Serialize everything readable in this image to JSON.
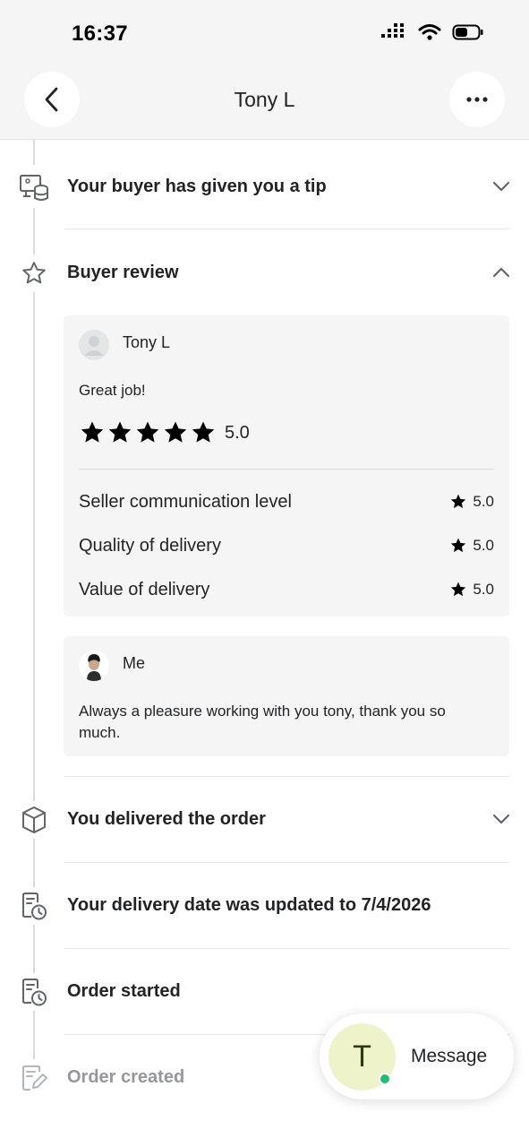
{
  "status_bar": {
    "time": "16:37"
  },
  "header": {
    "title": "Tony L"
  },
  "events": [
    {
      "title": "Your buyer has given you a tip",
      "icon": "tip-icon",
      "expanded": false
    },
    {
      "title": "Buyer review",
      "icon": "star-outline-icon",
      "expanded": true
    },
    {
      "title": "You delivered the order",
      "icon": "package-icon",
      "expanded": false
    },
    {
      "title": "Your delivery date was updated to 7/4/2026",
      "icon": "calendar-clock-icon"
    },
    {
      "title": "Order started",
      "icon": "calendar-clock-icon"
    },
    {
      "title": "Order created",
      "icon": "edit-document-icon"
    }
  ],
  "review": {
    "reviewer": "Tony L",
    "text": "Great job!",
    "stars": 5,
    "overall": "5.0",
    "ratings": [
      {
        "label": "Seller communication level",
        "value": "5.0"
      },
      {
        "label": "Quality of delivery",
        "value": "5.0"
      },
      {
        "label": "Value of delivery",
        "value": "5.0"
      }
    ]
  },
  "reply": {
    "author": "Me",
    "text": "Always a pleasure working with you tony, thank you so much."
  },
  "message_button": {
    "initial": "T",
    "label": "Message",
    "online": true
  },
  "colors": {
    "online": "#1dbf73",
    "text": "#222325",
    "muted": "#95979d",
    "card": "#f5f5f5"
  }
}
